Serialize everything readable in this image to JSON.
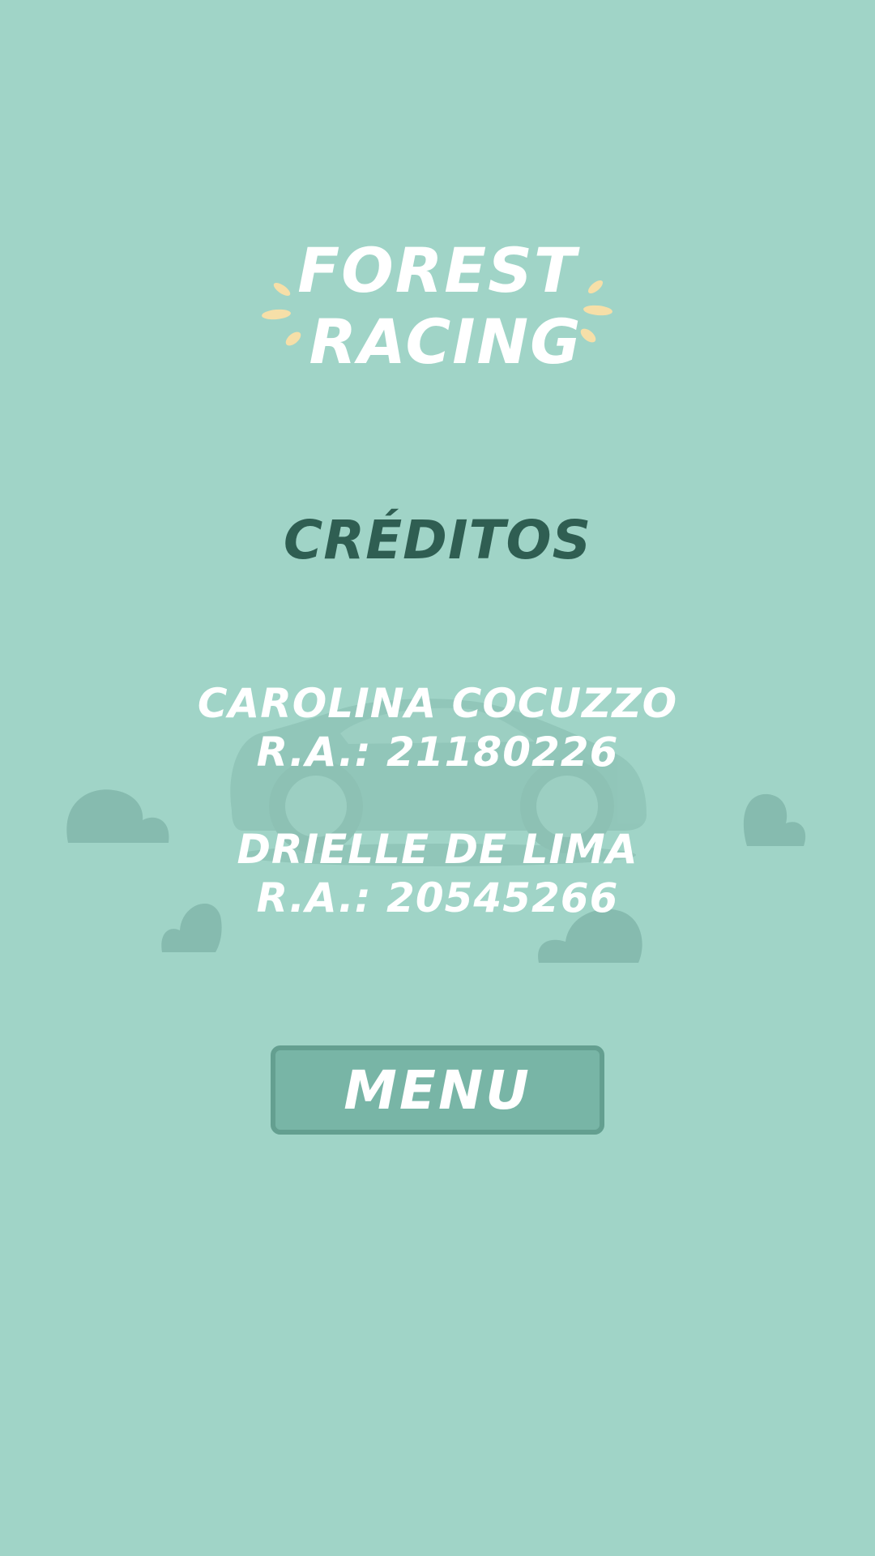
{
  "logo": {
    "line1": "FOREST",
    "line2": "RACING"
  },
  "credits_title": "CRÉDITOS",
  "credits": [
    {
      "name": "CAROLINA COCUZZO",
      "ra": "R.A.: 21180226"
    },
    {
      "name": "DRIELLE DE LIMA",
      "ra": "R.A.: 20545266"
    }
  ],
  "menu_button": {
    "label": "MENU"
  },
  "colors": {
    "background": "#a0d4c7",
    "title_text": "#2f5e52",
    "light_text": "#ffffff",
    "button_fill": "#78b5a6",
    "button_border": "#649f90",
    "logo_accent": "#f6dfa8"
  }
}
